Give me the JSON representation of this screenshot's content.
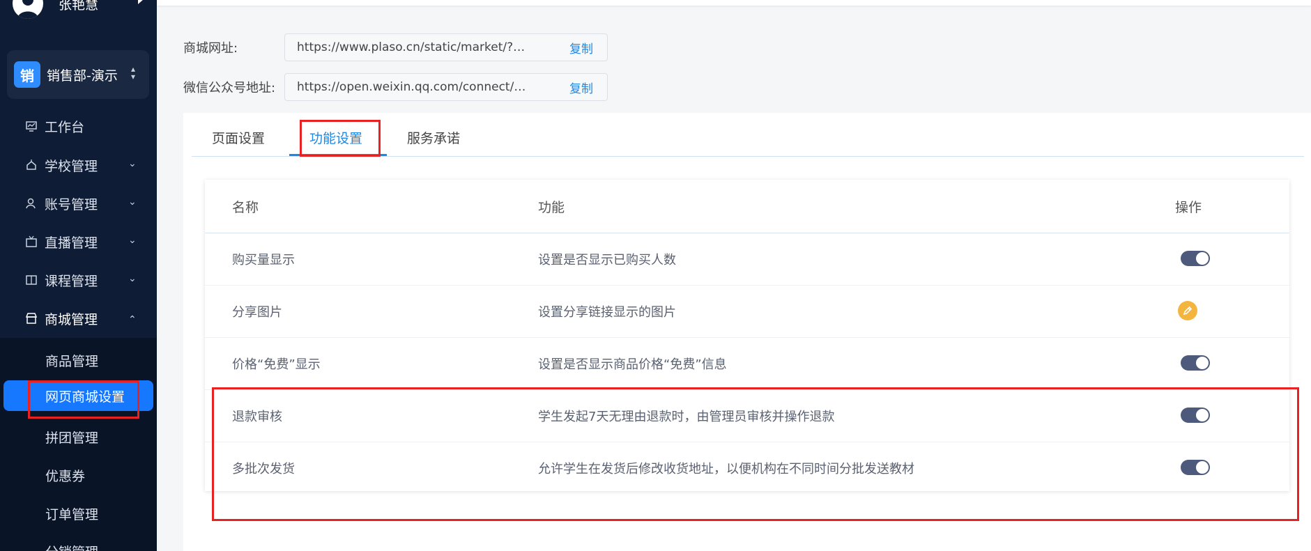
{
  "sidebar": {
    "user_name": "张艳慧",
    "org": {
      "badge": "销",
      "name": "销售部-演示"
    },
    "items": [
      {
        "label": "工作台",
        "icon": "dashboard-icon",
        "has_chevron": false
      },
      {
        "label": "学校管理",
        "icon": "school-icon",
        "has_chevron": true,
        "chevron": "⌄"
      },
      {
        "label": "账号管理",
        "icon": "user-icon",
        "has_chevron": true,
        "chevron": "⌄"
      },
      {
        "label": "直播管理",
        "icon": "live-icon",
        "has_chevron": true,
        "chevron": "⌄"
      },
      {
        "label": "课程管理",
        "icon": "book-icon",
        "has_chevron": true,
        "chevron": "⌄"
      },
      {
        "label": "商城管理",
        "icon": "store-icon",
        "has_chevron": true,
        "chevron": "⌃",
        "expanded": true
      }
    ],
    "sub_items": [
      {
        "label": "商品管理"
      },
      {
        "label": "网页商城设置",
        "active": true
      },
      {
        "label": "拼团管理"
      },
      {
        "label": "优惠券"
      },
      {
        "label": "订单管理"
      },
      {
        "label": "分销管理"
      }
    ]
  },
  "fields": [
    {
      "label": "商城网址:",
      "value": "https://www.plaso.cn/static/market/?appl...",
      "action": "复制"
    },
    {
      "label": "微信公众号地址:",
      "value": "https://open.weixin.qq.com/connect/oaut...",
      "action": "复制"
    }
  ],
  "tabs": [
    {
      "label": "页面设置"
    },
    {
      "label": "功能设置",
      "active": true
    },
    {
      "label": "服务承诺"
    }
  ],
  "table": {
    "headers": {
      "name": "名称",
      "function": "功能",
      "action": "操作"
    },
    "rows": [
      {
        "name": "购买量显示",
        "desc": "设置是否显示已购买人数",
        "control": "toggle",
        "enabled": true
      },
      {
        "name": "分享图片",
        "desc": "设置分享链接显示的图片",
        "control": "edit",
        "enabled": null
      },
      {
        "name": "价格“免费”显示",
        "desc": "设置是否显示商品价格“免费”信息",
        "control": "toggle",
        "enabled": true
      },
      {
        "name": "退款审核",
        "desc": "学生发起7天无理由退款时，由管理员审核并操作退款",
        "control": "toggle",
        "enabled": true
      },
      {
        "name": "多批次发货",
        "desc": "允许学生在发货后修改收货地址，以便机构在不同时间分批发送教材",
        "control": "toggle",
        "enabled": true
      }
    ]
  },
  "colors": {
    "sidebar_bg": "#0f1c35",
    "accent": "#1e88e5",
    "active_item": "#1677ff",
    "toggle_on": "#4e5a7c",
    "edit_button": "#f4b53f",
    "highlight": "#e62222"
  }
}
